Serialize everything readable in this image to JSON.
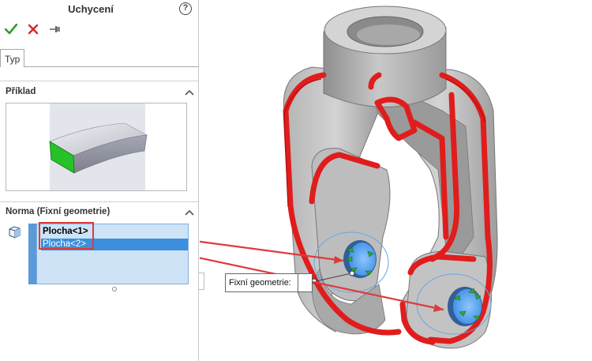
{
  "panel": {
    "title": "Uchycení",
    "help_symbol": "?",
    "actions": [
      "confirm-check-icon",
      "cancel-x-icon",
      "pin-icon"
    ],
    "tab_label": "Typ"
  },
  "example_group": {
    "header": "Příklad"
  },
  "norm_group": {
    "header": "Norma (Fixní geometrie)",
    "items": [
      "Plocha<1>",
      "Plocha<2>"
    ],
    "selected_index": 1
  },
  "callout": {
    "label": "Fixní geometrie:"
  },
  "colors": {
    "accent_red": "#de3b3b",
    "selection_blue": "#3c8fdc",
    "list_bg": "#cfe3f6",
    "part_gray": "#c4c4c4",
    "fillet_red": "#e01d1d",
    "face_blue": "#5aa6ef",
    "fixture_green": "#2fa82f"
  }
}
